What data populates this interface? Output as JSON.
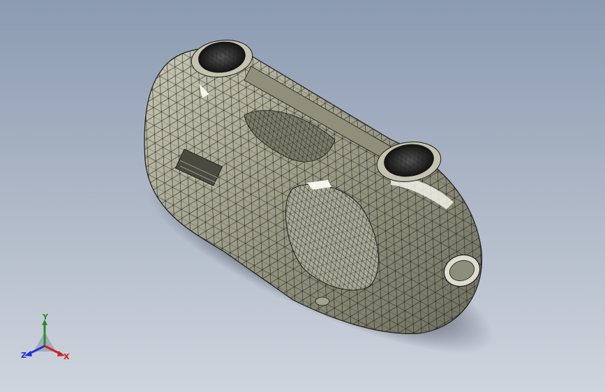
{
  "app": {
    "view": "model-viewport"
  },
  "colors": {
    "background_top": "#8b9bb2",
    "background_bottom": "#cfd5de",
    "model_fill": "#b8b8a3",
    "mesh_stroke": "#1a1a1a",
    "axis_x": "#cc2222",
    "axis_y": "#2a8a2a",
    "axis_z": "#2233cc"
  },
  "triad": {
    "x_label": "X",
    "y_label": "Y",
    "z_label": "Z"
  }
}
